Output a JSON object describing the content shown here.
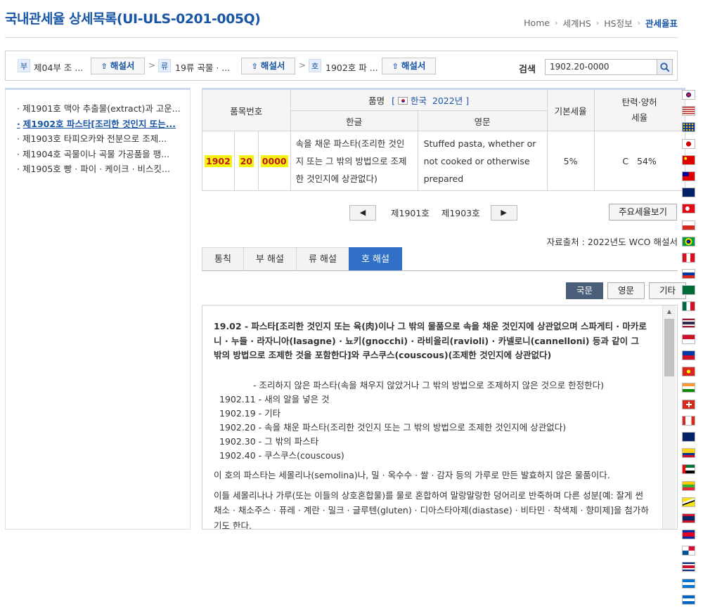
{
  "header": {
    "title": "국내관세율 상세목록(UI-ULS-0201-005Q)",
    "breadcrumbs": [
      "Home",
      "세계HS",
      "HS정보",
      "관세율표"
    ]
  },
  "nav": {
    "section_badge": "부",
    "section_text": "제04부 조 ...",
    "chapter_badge": "류",
    "chapter_text": "19류 곡물 · ...",
    "heading_badge": "호",
    "heading_text": "1902호 파 ...",
    "explain_label": "해설서",
    "search_label": "검색",
    "search_value": "1902.20-0000"
  },
  "sidebar": {
    "items": [
      "제1901호 맥아 추출물(extract)과 고운...",
      "제1902호 파스타[조리한 것인지 또는...",
      "제1903호 타피오카와 전분으로 조제...",
      "제1904호 곡물이나 곡물 가공품을 팽...",
      "제1905호 빵 · 파이 · 케이크 · 비스킷..."
    ],
    "selected_index": 1
  },
  "table": {
    "col_code": "품목번호",
    "col_name": "품명",
    "country": "한국",
    "year": "2022년",
    "col_kor": "한글",
    "col_eng": "영문",
    "col_basic": "기본세율",
    "col_flex": "탄력·양허\n세율",
    "code1": "1902",
    "code2": "20",
    "code3": "0000",
    "name_kor": "속을 채운 파스타(조리한 것인지 또는 그 밖의 방법으로 조제한 것인지에 상관없다)",
    "name_eng": "Stuffed pasta, whether or not cooked or otherwise prepared",
    "basic_rate": "5%",
    "flex_type": "C",
    "flex_rate": "54%"
  },
  "pager": {
    "prev_icon": "◀",
    "prev_label": "제1901호",
    "next_label": "제1903호",
    "next_icon": "▶",
    "main_rates_label": "주요세율보기"
  },
  "source_text": "자료출처 : 2022년도 WCO 해설서",
  "tabs": [
    "통칙",
    "부 해설",
    "류 해설",
    "호 해설"
  ],
  "active_tab": 3,
  "lang_buttons": [
    "국문",
    "영문",
    "기타"
  ],
  "active_lang": 0,
  "content": {
    "heading": "19.02 - 파스타[조리한 것인지 또는 육(肉)이나 그 밖의 물품으로 속을 채운 것인지에 상관없으며 스파게티 · 마카로니 · 누들 · 라자니아(lasagne) · 뇨키(gnocchi) · 라비올리(ravioli) · 카넬로니(cannelloni) 등과 같이 그 밖의 방법으로 조제한 것을 포함한다]와 쿠스쿠스(couscous)(조제한 것인지에 상관없다)",
    "sub_lines": [
      "- 조리하지 않은 파스타(속을 채우지 않았거나 그 밖의 방법으로 조제하지 않은 것으로 한정한다)",
      "1902.11 - 새의 알을 넣은 것",
      "1902.19 - 기타",
      "1902.20 - 속을 채운 파스타(조리한 것인지 또는 그 밖의 방법으로 조제한 것인지에 상관없다)",
      "1902.30 - 그 밖의 파스타",
      "1902.40 - 쿠스쿠스(couscous)"
    ],
    "para1": "이 호의 파스타는 세몰리나(semolina)나, 밀 · 옥수수 · 쌀 · 감자 등의 가루로 만든 발효하지 않은 물품이다.",
    "para2": "이들 세몰리나나 가루(또는 이들의 상호혼합물)를 물로 혼합하여 말랑말랑한 덩어리로 반죽하며 다른 성분[예: 잘게 썬 채소 · 채소주스 · 퓨레 · 계란 · 밀크 · 글루텐(gluten) · 디아스타아제(diastase) · 비타민 · 착색제 · 향미제]을 첨가하기도 한다."
  },
  "flags": [
    "korea",
    "usa",
    "eu",
    "japan",
    "china",
    "taiwan",
    "australia",
    "turkey",
    "chile",
    "brazil",
    "peru",
    "russia",
    "saudi",
    "mexico",
    "thailand",
    "indonesia",
    "philippines",
    "vietnam",
    "india",
    "switzerland",
    "canada",
    "new-zealand",
    "colombia",
    "uae",
    "myanmar",
    "brunei",
    "laos",
    "cambodia",
    "panama",
    "costa-rica",
    "honduras",
    "nicaragua"
  ]
}
